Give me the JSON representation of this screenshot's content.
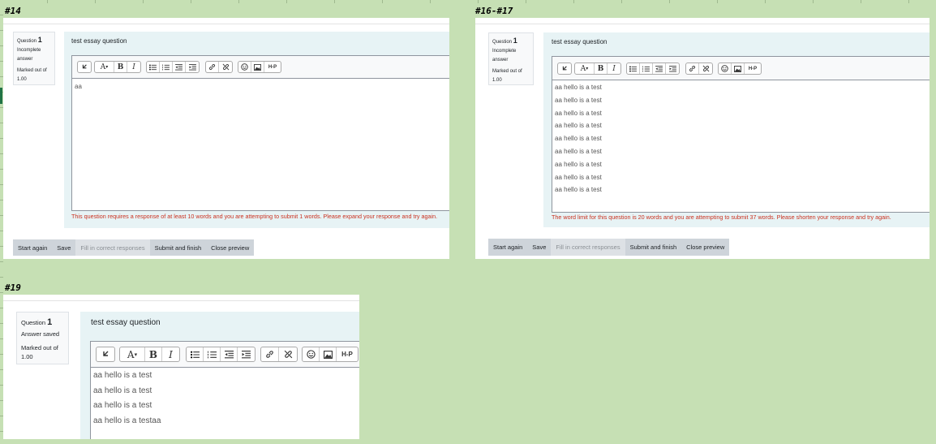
{
  "panels": [
    {
      "label": "#14",
      "question_label": "Question",
      "question_number": "1",
      "state": "Incomplete answer",
      "mark": "Marked out of 1.00",
      "question_text": "test essay question",
      "response_lines": [
        "aa"
      ],
      "validation": "This question requires a response of at least 10 words and you are attempting to submit 1 words. Please expand your response and try again.",
      "has_footer": true
    },
    {
      "label": "#16-#17",
      "question_label": "Question",
      "question_number": "1",
      "state": "Incomplete answer",
      "mark": "Marked out of 1.00",
      "question_text": "test essay question",
      "response_lines": [
        "aa hello is a test",
        "aa hello is a test",
        "aa hello is a test",
        "aa hello is a test",
        "aa hello is a test",
        "aa hello is a test",
        "aa hello is a test",
        "aa hello is a test",
        "aa hello is a test"
      ],
      "validation": "The word limit for this question is 20 words and you are attempting to submit 37 words. Please shorten your response and try again.",
      "has_footer": true
    },
    {
      "label": "#19",
      "question_label": "Question",
      "question_number": "1",
      "state": "Answer saved",
      "mark": "Marked out of 1.00",
      "question_text": "test essay question",
      "response_lines": [
        "aa hello is a test",
        "aa hello is a test",
        "aa hello is a test",
        "aa hello is a testaa"
      ],
      "validation": "",
      "has_footer": false
    }
  ],
  "toolbar": {
    "font_label": "A",
    "bold_label": "B",
    "italic_label": "I",
    "h5p_label": "H-P",
    "icons": [
      "undo-icon",
      "text-color-icon",
      "bold-icon",
      "italic-icon",
      "bullet-list-icon",
      "numbered-list-icon",
      "outdent-icon",
      "indent-icon",
      "link-icon",
      "unlink-icon",
      "emoji-icon",
      "image-icon",
      "h5p-icon"
    ]
  },
  "footer": {
    "start_again": "Start again",
    "save": "Save",
    "fill_correct": "Fill in correct responses",
    "submit_finish": "Submit and finish",
    "close_preview": "Close preview"
  },
  "colors": {
    "background": "#c6e0b4",
    "formulation": "#e7f3f5",
    "validation": "#ca3120",
    "footer": "#ced4da"
  }
}
